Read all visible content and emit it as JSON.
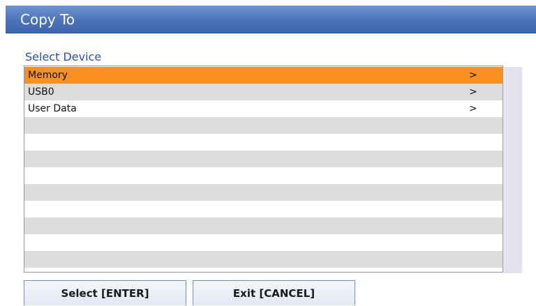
{
  "dialog": {
    "title": "Copy To"
  },
  "device_list": {
    "label": "Select Device",
    "selected_index": 0,
    "items": [
      {
        "label": "Memory",
        "arrow": ">"
      },
      {
        "label": "USB0",
        "arrow": ">"
      },
      {
        "label": "User Data",
        "arrow": ">"
      }
    ],
    "empty_rows": 9,
    "colors": {
      "selected": "#f7901e",
      "stripe": "#dcdcdc",
      "plain": "#ffffff"
    }
  },
  "buttons": {
    "select_label": "Select [ENTER]",
    "exit_label": "Exit [CANCEL]"
  },
  "theme": {
    "title_bar": "#4a74ba",
    "label_text": "#2f4fb1"
  }
}
